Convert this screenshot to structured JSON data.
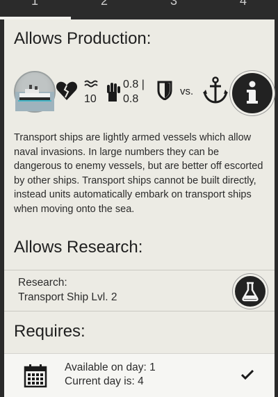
{
  "tabs": [
    {
      "label": "1"
    },
    {
      "label": "2"
    },
    {
      "label": "3"
    },
    {
      "label": "4"
    }
  ],
  "production": {
    "title": "Allows Production:",
    "stats": {
      "movement": "10",
      "attack": "0.8 |",
      "attack2": "0.8",
      "vs_label": "vs."
    },
    "description": "Transport ships are lightly armed vessels which allow naval invasions. In large numbers they can be dangerous to enemy vessels, but are better off escorted by other ships. Transport ships cannot be built directly, instead units automatically embark on transport ships when moving onto the sea."
  },
  "research": {
    "title": "Allows Research:",
    "label": "Research:",
    "item": "Transport Ship Lvl. 2"
  },
  "requires": {
    "title": "Requires:",
    "available": "Available on day: 1",
    "current": "Current day is: 4"
  }
}
